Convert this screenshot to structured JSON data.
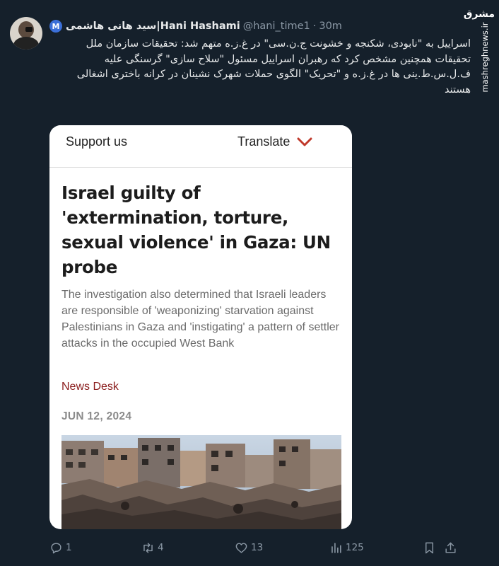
{
  "tweet": {
    "display_name": "سید هانی هاشمی|Hani Hashami",
    "badge_letter": "M",
    "handle": "@hani_time1",
    "separator": "·",
    "time": "30m",
    "text_lines": [
      "اسراییل به \"نابودی، شکنجه و خشونت ج.ن.سی\" در غ.ز.ه متهم شد: تحقیقات سازمان ملل",
      "تحقیقات همچنین مشخص کرد که رهبران اسراییل مسئول \"سلاح سازی\" گرسنگی علیه ف.ل.س.ط.ینی ها در غ.ز.ه و \"تحریک\" الگوی حملات شهرک نشینان در کرانه باختری اشغالی هستند"
    ]
  },
  "watermark": {
    "logo": "مشرق",
    "site": "mashreghnews.ir"
  },
  "card": {
    "support_label": "Support us",
    "translate_label": "Translate",
    "headline": "Israel guilty of 'extermination, torture, sexual violence' in Gaza: UN probe",
    "summary": "The investigation also determined that Israeli leaders are responsible of 'weaponizing' starvation against Palestinians in Gaza and 'instigating' a pattern of settler attacks in the occupied West Bank",
    "author": "News Desk",
    "date": "JUN 12, 2024"
  },
  "actions": {
    "replies": "1",
    "reposts": "4",
    "likes": "13",
    "views": "125"
  },
  "colors": {
    "background": "#15202b",
    "card_background": "#ffffff",
    "accent_red": "#c0392b",
    "author_red": "#8a1c1c",
    "muted": "#8b98a5",
    "badge": "#3b6fd8"
  }
}
